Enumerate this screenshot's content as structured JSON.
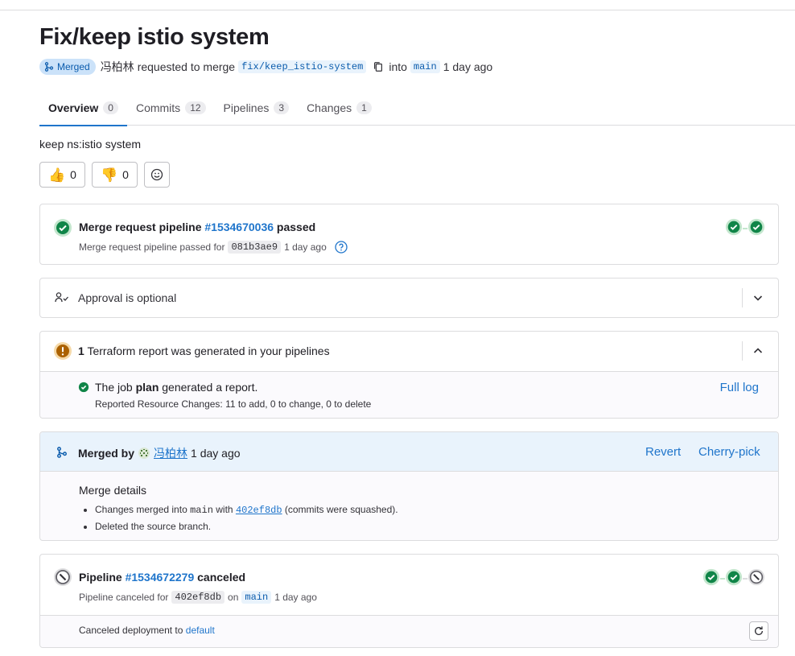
{
  "title": "Fix/keep istio system",
  "meta": {
    "status_badge": "Merged",
    "author": "冯柏林",
    "requested_text": "requested to merge",
    "source_branch": "fix/keep_istio-system",
    "into_text": "into",
    "target_branch": "main",
    "time": "1 day ago"
  },
  "tabs": [
    {
      "label": "Overview",
      "count": "0"
    },
    {
      "label": "Commits",
      "count": "12"
    },
    {
      "label": "Pipelines",
      "count": "3"
    },
    {
      "label": "Changes",
      "count": "1"
    }
  ],
  "description": "keep ns:istio system",
  "reactions": {
    "thumbs_up": "0",
    "thumbs_down": "0"
  },
  "mr_pipeline": {
    "title_prefix": "Merge request pipeline",
    "pipeline_id": "#1534670036",
    "status_word": "passed",
    "subtitle_prefix": "Merge request pipeline passed for",
    "commit": "081b3ae9",
    "time": "1 day ago"
  },
  "approval": {
    "label": "Approval is optional"
  },
  "terraform": {
    "count": "1",
    "title_rest": "Terraform report was generated in your pipelines",
    "job_prefix": "The job",
    "job_name": "plan",
    "job_suffix": "generated a report.",
    "changes": "Reported Resource Changes: 11 to add, 0 to change, 0 to delete",
    "full_log": "Full log"
  },
  "merged": {
    "prefix": "Merged by",
    "user": "冯柏林",
    "time": "1 day ago",
    "revert": "Revert",
    "cherry_pick": "Cherry-pick",
    "details_title": "Merge details",
    "line1_prefix": "Changes merged into",
    "line1_branch": "main",
    "line1_with": "with",
    "line1_commit": "402ef8db",
    "line1_suffix": "(commits were squashed).",
    "line2": "Deleted the source branch."
  },
  "post_pipeline": {
    "title_prefix": "Pipeline",
    "pipeline_id": "#1534672279",
    "status_word": "canceled",
    "subtitle_prefix": "Pipeline canceled for",
    "commit": "402ef8db",
    "on_text": "on",
    "branch": "main",
    "time": "1 day ago",
    "deployment_prefix": "Canceled deployment to",
    "environment": "default"
  },
  "colors": {
    "accent": "#1f75cb",
    "success": "#108548",
    "warning": "#ab6100",
    "merged_bg": "#e9f3fc",
    "canceled": "#626168"
  }
}
